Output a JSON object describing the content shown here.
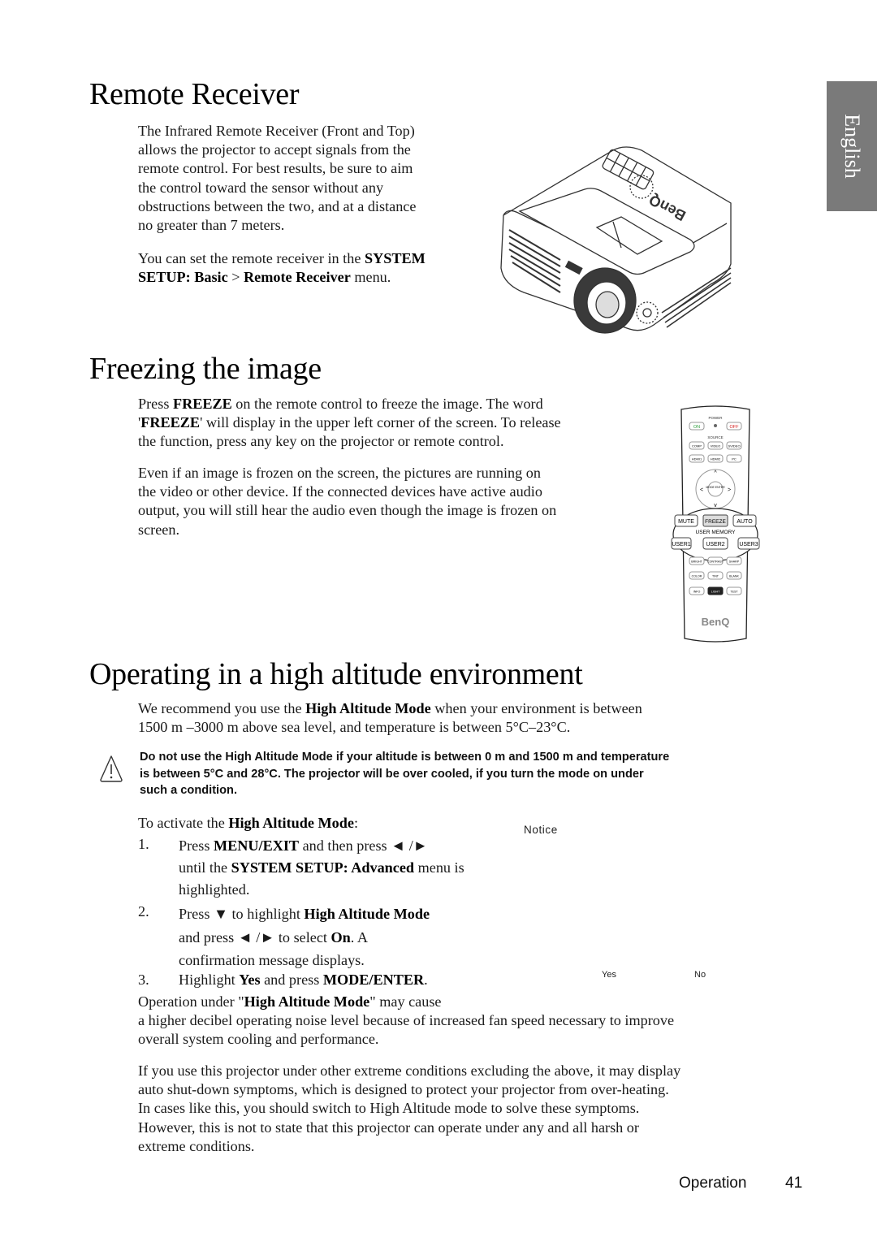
{
  "side_tab": {
    "label": "English"
  },
  "section_remote": {
    "title": "Remote Receiver",
    "para1_lines": [
      "The Infrared Remote Receiver (Front and Top)",
      "allows the projector to accept signals from the",
      "remote control. For best results, be sure to aim",
      "the control toward the sensor without any",
      "obstructions between the two, and at a distance",
      "no greater than 7 meters."
    ],
    "para2_pre": "You can set the remote receiver in the ",
    "para2_bold1": "SYSTEM",
    "para2_bold2": "SETUP: Basic",
    "para2_gt": " > ",
    "para2_bold3": "Remote Receiver",
    "para2_post": " menu.",
    "figure": {
      "alt": "projector-illustration",
      "brand": "BenQ"
    }
  },
  "section_freeze": {
    "title": "Freezing the image",
    "p1_l1_pre": "Press ",
    "p1_l1_bold": "FREEZE",
    "p1_l1_post": " on the remote control to freeze the image. The word",
    "p1_l2_pre": "'",
    "p1_l2_bold": "FREEZE",
    "p1_l2_post": "' will display in the upper left corner of the screen. To release",
    "p1_l3": "the function, press any key on the projector or remote control.",
    "p2_lines": [
      "Even if an image is frozen on the screen, the pictures are running on",
      "the video or other device. If the connected devices have active audio",
      "output, you will still hear the audio even though the image is frozen on",
      "screen."
    ],
    "remote": {
      "power_label": "POWER",
      "on": "ON",
      "off": "OFF",
      "source_label": "SOURCE",
      "source_row1": [
        "COMP",
        "VIDEO",
        "SVIDEO"
      ],
      "source_row2": [
        "HDMI1",
        "HDMI2",
        "PC"
      ],
      "enter": "MODE ENTER",
      "row_mute": [
        "MUTE",
        "FREEZE",
        "AUTO"
      ],
      "user_memory": "USER MEMORY",
      "user_row": [
        "USER1",
        "USER2",
        "USER3"
      ],
      "row_a": [
        "BRIGHT",
        "CONTRAST",
        "SHARP"
      ],
      "row_b": [
        "COLOR",
        "TINT",
        "BLANK"
      ],
      "row_c": [
        "INFO",
        "LIGHT",
        "TEST"
      ],
      "brand": "BenQ"
    }
  },
  "section_altitude": {
    "title": "Operating in a high altitude environment",
    "intro_l1_pre": "We recommend you use the ",
    "intro_l1_bold": "High Altitude Mode",
    "intro_l1_post": " when your environment is between",
    "intro_l2": "1500 m –3000 m above sea level, and temperature is between 5°C–23°C.",
    "warning_lines": [
      "Do not use the High Altitude Mode if your altitude is between 0 m and 1500 m and temperature",
      "is between 5°C and 28°C. The projector will be over cooled, if you turn the mode on under",
      "such a condition."
    ],
    "activate_pre": "To activate the ",
    "activate_bold": "High Altitude Mode",
    "activate_post": ":",
    "notice_label": "Notice",
    "steps": [
      {
        "num": "1.",
        "l1_pre": "Press ",
        "l1_bold": "MENU/EXIT",
        "l1_post": " and then press ◄ /►",
        "l2_pre": "until the ",
        "l2_bold": "SYSTEM SETUP: Advanced",
        "l2_post": " menu is",
        "l3": "highlighted."
      },
      {
        "num": "2.",
        "l1_pre": "Press ▼  to highlight ",
        "l1_bold": "High Altitude Mode",
        "l2_pre": "and press ◄ /►  to select ",
        "l2_bold": "On",
        "l2_post": ". A",
        "l3": "confirmation message displays."
      },
      {
        "num": "3.",
        "l1_pre": "Highlight ",
        "l1_bold": "Yes",
        "l1_mid": " and press ",
        "l1_bold2": "MODE/ENTER",
        "l1_post": "."
      }
    ],
    "dialog_yes": "Yes",
    "dialog_no": "No",
    "op_l1_pre": "Operation under \"",
    "op_l1_bold": "High Altitude Mode",
    "op_l1_post": "\" may cause",
    "op_lines": [
      "a higher decibel operating noise level because of increased fan speed necessary to improve",
      "overall system cooling and performance."
    ],
    "extreme_lines": [
      "If you use this projector under other extreme conditions excluding the above, it may display",
      "auto shut-down symptoms, which is designed to protect your projector from over-heating.",
      "In cases like this, you should switch to High Altitude mode to solve these symptoms.",
      "However, this is not to state that this projector can operate under any and all harsh or",
      "extreme conditions."
    ]
  },
  "footer": {
    "section": "Operation",
    "page": "41"
  }
}
